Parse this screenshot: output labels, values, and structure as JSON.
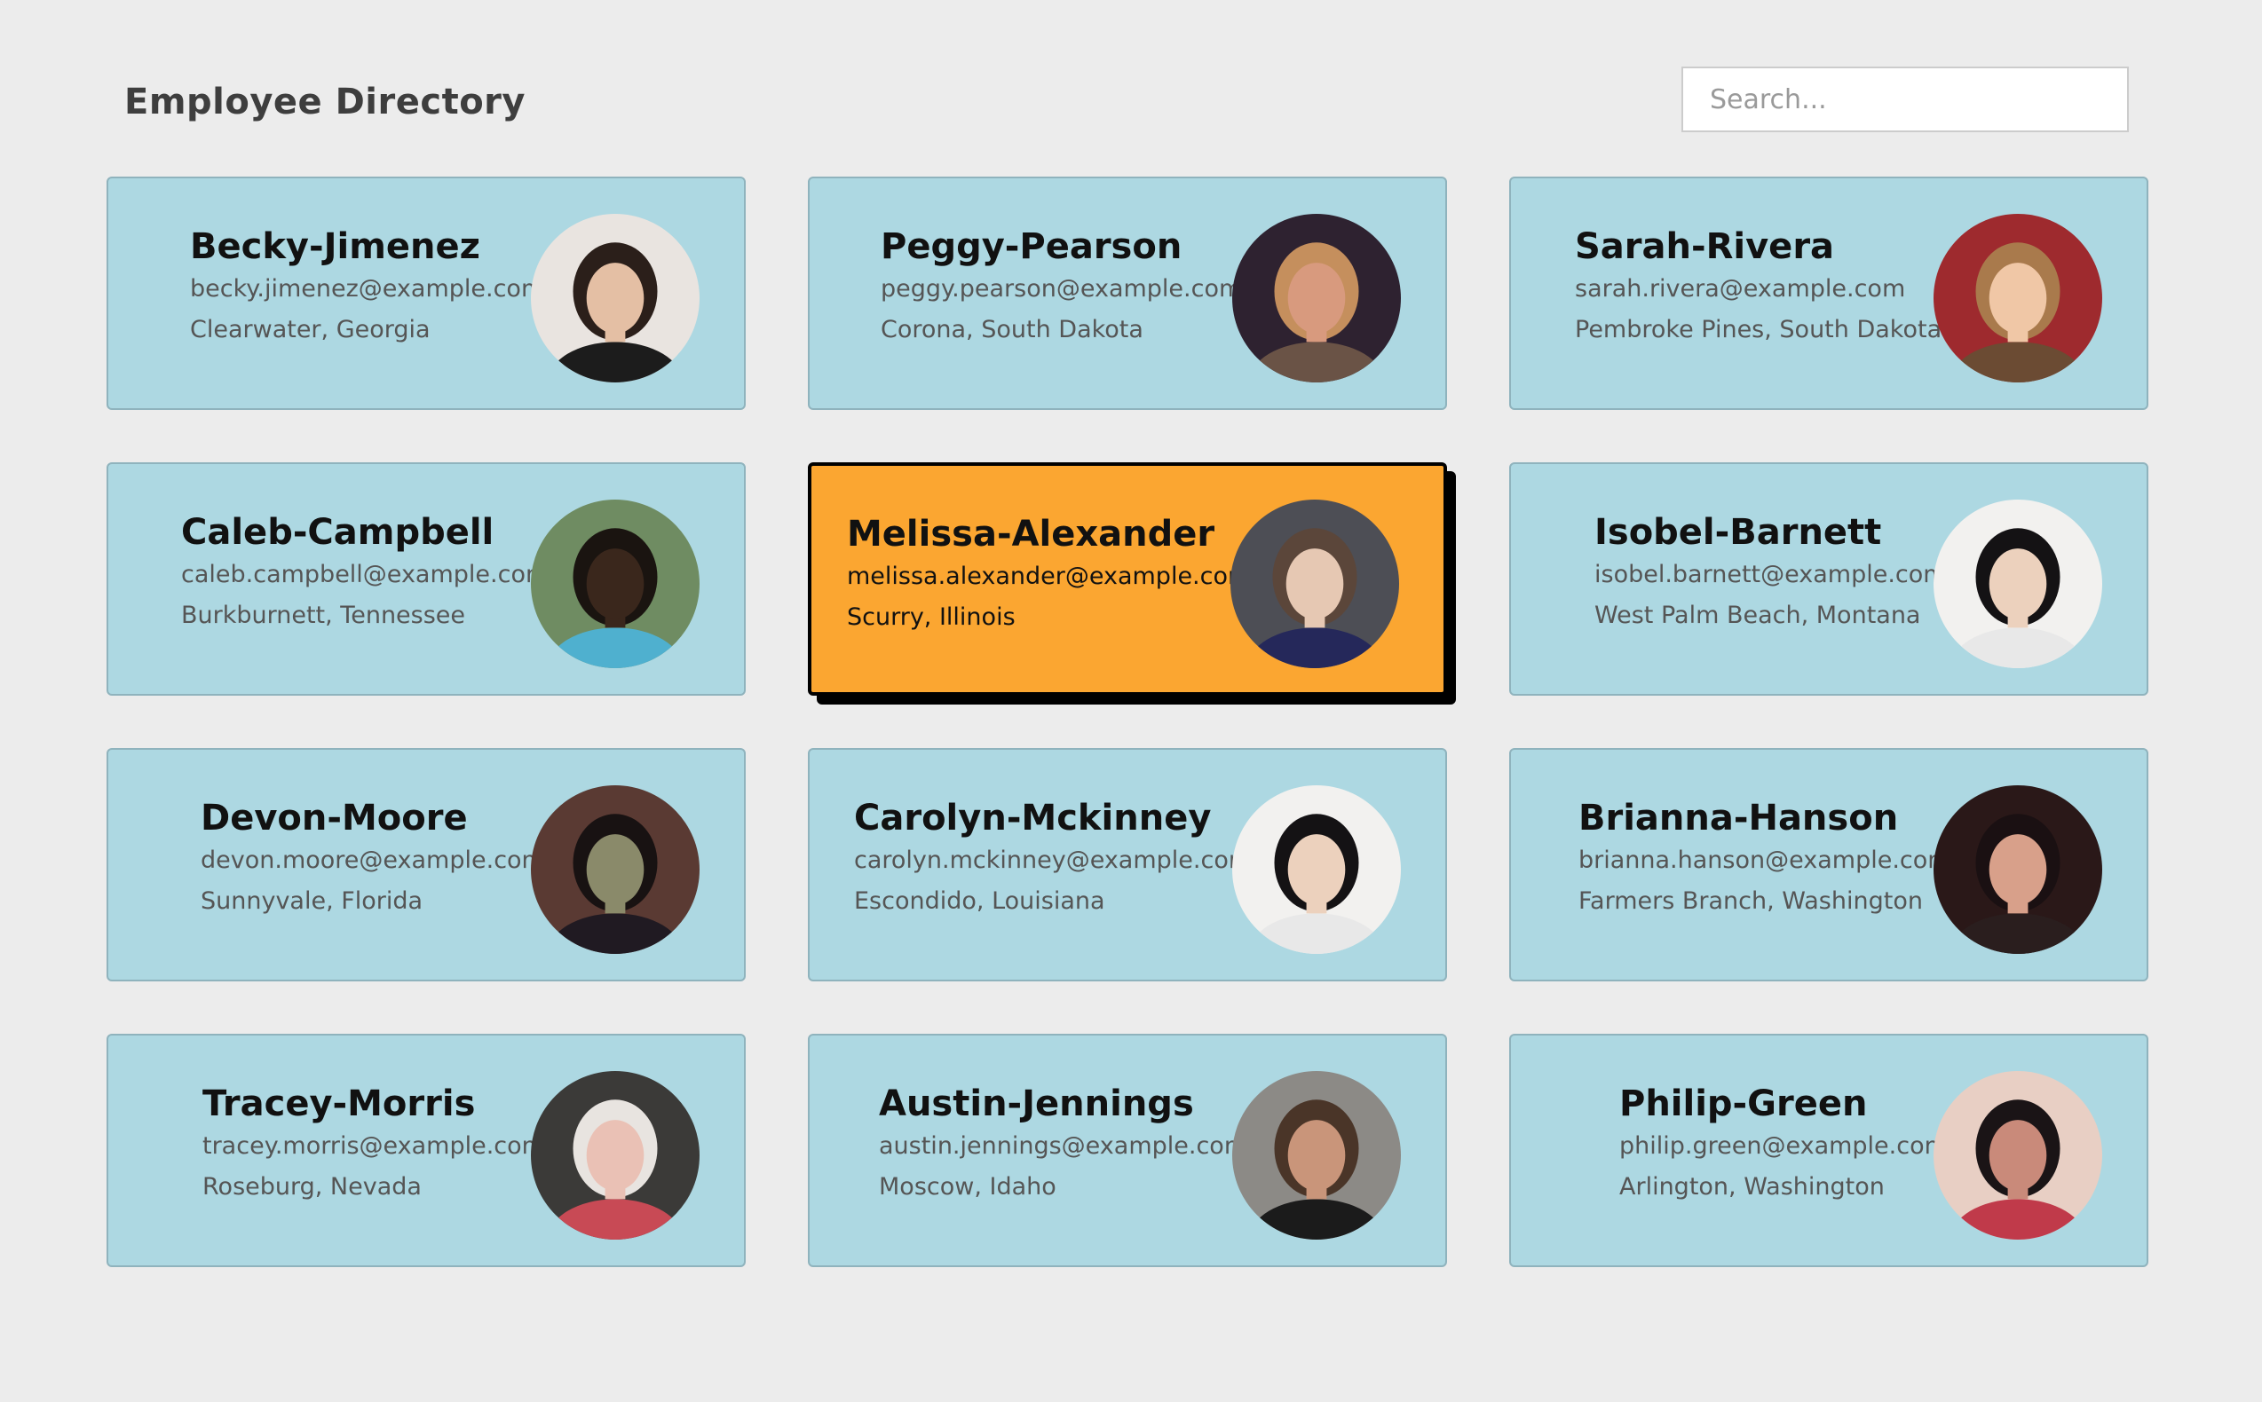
{
  "header": {
    "title": "Employee Directory",
    "search_placeholder": "Search..."
  },
  "employees": [
    {
      "name": "Becky-Jimenez",
      "email": "becky.jimenez@example.com",
      "location": "Clearwater, Georgia",
      "avatar": {
        "bg": "#e9e4e0",
        "hair": "#2b1f1a",
        "skin": "#e4bfa4",
        "shirt": "#1c1c1c"
      }
    },
    {
      "name": "Peggy-Pearson",
      "email": "peggy.pearson@example.com",
      "location": "Corona, South Dakota",
      "avatar": {
        "bg": "#2e2230",
        "hair": "#c58f5d",
        "skin": "#d89a7e",
        "shirt": "#6a5346"
      }
    },
    {
      "name": "Sarah-Rivera",
      "email": "sarah.rivera@example.com",
      "location": "Pembroke Pines, South Dakota",
      "avatar": {
        "bg": "#9e2a2e",
        "hair": "#a97a4c",
        "skin": "#f0c7a6",
        "shirt": "#6b4b33"
      }
    },
    {
      "name": "Caleb-Campbell",
      "email": "caleb.campbell@example.com",
      "location": "Burkburnett, Tennessee",
      "avatar": {
        "bg": "#6f8c62",
        "hair": "#1a1410",
        "skin": "#3a271c",
        "shirt": "#4fb0cf"
      }
    },
    {
      "name": "Melissa-Alexander",
      "email": "melissa.alexander@example.com",
      "location": "Scurry, Illinois",
      "avatar": {
        "bg": "#4d4e55",
        "hair": "#5b463a",
        "skin": "#e6c8b3",
        "shirt": "#25285a"
      }
    },
    {
      "name": "Isobel-Barnett",
      "email": "isobel.barnett@example.com",
      "location": "West Palm Beach, Montana",
      "avatar": {
        "bg": "#f2f1ef",
        "hair": "#141214",
        "skin": "#ecd1bd",
        "shirt": "#e8e8e8"
      }
    },
    {
      "name": "Devon-Moore",
      "email": "devon.moore@example.com",
      "location": "Sunnyvale, Florida",
      "avatar": {
        "bg": "#5a3a33",
        "hair": "#181212",
        "skin": "#8a8a6a",
        "shirt": "#201a22"
      }
    },
    {
      "name": "Carolyn-Mckinney",
      "email": "carolyn.mckinney@example.com",
      "location": "Escondido, Louisiana",
      "avatar": {
        "bg": "#f2f1ef",
        "hair": "#141214",
        "skin": "#ecd1bd",
        "shirt": "#e8e8e8"
      }
    },
    {
      "name": "Brianna-Hanson",
      "email": "brianna.hanson@example.com",
      "location": "Farmers Branch, Washington",
      "avatar": {
        "bg": "#2a1818",
        "hair": "#1a1012",
        "skin": "#d8a08a",
        "shirt": "#2a1e1e"
      }
    },
    {
      "name": "Tracey-Morris",
      "email": "tracey.morris@example.com",
      "location": "Roseburg, Nevada",
      "avatar": {
        "bg": "#3b3a38",
        "hair": "#e8e4e0",
        "skin": "#eac1b5",
        "shirt": "#c84a55"
      }
    },
    {
      "name": "Austin-Jennings",
      "email": "austin.jennings@example.com",
      "location": "Moscow, Idaho",
      "avatar": {
        "bg": "#8c8a86",
        "hair": "#4a3528",
        "skin": "#c9957a",
        "shirt": "#1b1b1b"
      }
    },
    {
      "name": "Philip-Green",
      "email": "philip.green@example.com",
      "location": "Arlington, Washington",
      "avatar": {
        "bg": "#e8cfc4",
        "hair": "#1a1416",
        "skin": "#c98a7a",
        "shirt": "#c03a4a"
      }
    }
  ],
  "selected_index": 4
}
